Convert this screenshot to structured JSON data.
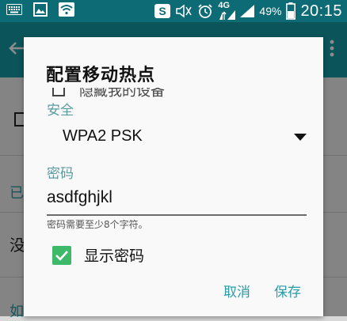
{
  "status_bar": {
    "network": "4G",
    "battery": "49%",
    "time": "20:15",
    "icons": [
      "keyboard-icon",
      "image-icon",
      "wifi-icon",
      "s-app-icon",
      "silent-icon",
      "alarm-icon",
      "signal-icon",
      "battery-icon"
    ]
  },
  "dialog": {
    "title": "配置移动热点",
    "partial_option": "隐藏我的设备",
    "security_label": "安全",
    "security_value": "WPA2 PSK",
    "password_label": "密码",
    "password_value": "asdfghjkl",
    "password_hint": "密码需要至少8个字符。",
    "show_password_label": "显示密码",
    "show_password_checked": true,
    "cancel_label": "取消",
    "save_label": "保存"
  },
  "background": {
    "frag_1": "已",
    "frag_2": "没",
    "frag_3": "如"
  },
  "colors": {
    "statusbar": "#0c6b74",
    "appbar": "#159aa5",
    "accent": "#2a9ca6",
    "checkbox": "#3cba6a"
  }
}
